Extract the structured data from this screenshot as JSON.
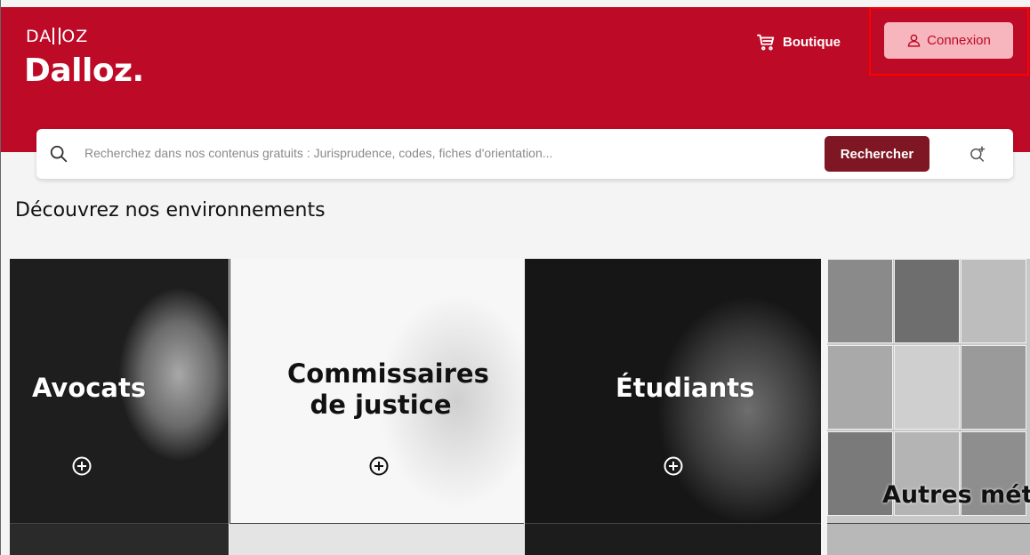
{
  "brand": {
    "small_logo_left": "DA",
    "small_logo_right": "OZ",
    "name": "Dalloz."
  },
  "header": {
    "boutique_label": "Boutique",
    "connexion_label": "Connexion"
  },
  "search": {
    "placeholder": "Recherchez dans nos contenus gratuits : Jurisprudence, codes, fiches d'orientation...",
    "button_label": "Rechercher"
  },
  "section": {
    "title": "Découvrez nos environnements"
  },
  "tiles": [
    {
      "label": "Avocats"
    },
    {
      "label_line1": "Commissaires",
      "label_line2": "de justice"
    },
    {
      "label": "Étudiants"
    },
    {
      "label": "Autres métiers"
    }
  ],
  "colors": {
    "brand_red": "#bd0a26",
    "button_dark_red": "#7f1623",
    "connexion_bg": "#f7b5bd",
    "highlight_frame": "#ff0000"
  }
}
